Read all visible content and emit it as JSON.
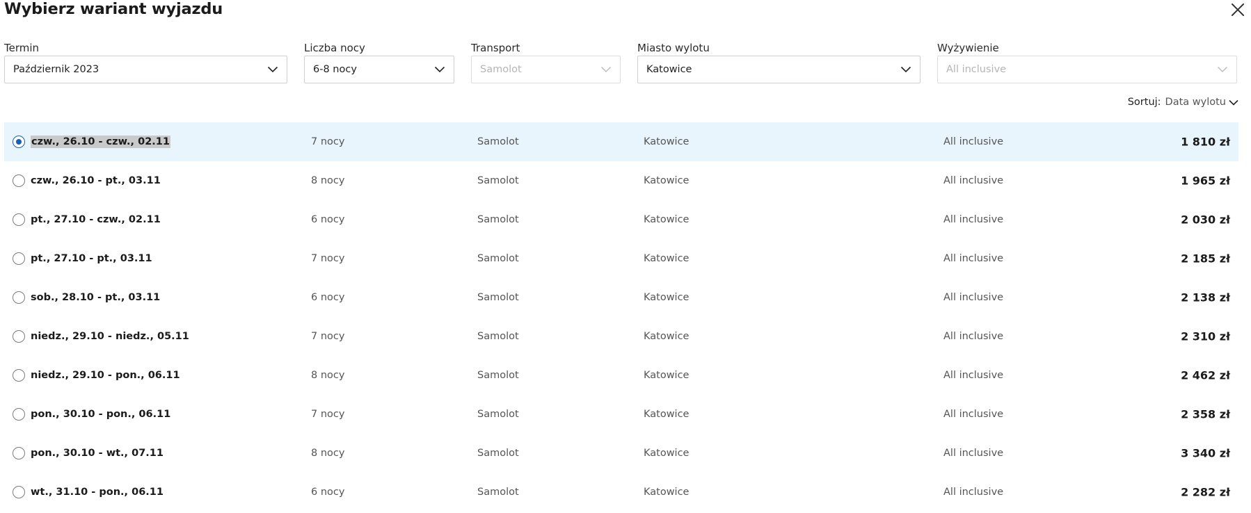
{
  "header": {
    "title": "Wybierz wariant wyjazdu",
    "close_icon": "close-icon"
  },
  "filters": [
    {
      "label": "Termin",
      "value": "Październik 2023",
      "disabled": false
    },
    {
      "label": "Liczba nocy",
      "value": "6-8 nocy",
      "disabled": false
    },
    {
      "label": "Transport",
      "value": "Samolot",
      "disabled": true
    },
    {
      "label": "Miasto wylotu",
      "value": "Katowice",
      "disabled": false
    },
    {
      "label": "Wyżywienie",
      "value": "All inclusive",
      "disabled": true
    }
  ],
  "sort": {
    "label": "Sortuj:",
    "value": "Data wylotu"
  },
  "colors": {
    "selected_row_bg": "#e9f5fc",
    "radio_accent": "#1a5fb4"
  },
  "rows": [
    {
      "dates": "czw., 26.10 - czw., 02.11",
      "nights": "7 nocy",
      "transport": "Samolot",
      "city": "Katowice",
      "board": "All inclusive",
      "price": "1 810 zł",
      "selected": true
    },
    {
      "dates": "czw., 26.10 - pt., 03.11",
      "nights": "8 nocy",
      "transport": "Samolot",
      "city": "Katowice",
      "board": "All inclusive",
      "price": "1 965 zł",
      "selected": false
    },
    {
      "dates": "pt., 27.10 - czw., 02.11",
      "nights": "6 nocy",
      "transport": "Samolot",
      "city": "Katowice",
      "board": "All inclusive",
      "price": "2 030 zł",
      "selected": false
    },
    {
      "dates": "pt., 27.10 - pt., 03.11",
      "nights": "7 nocy",
      "transport": "Samolot",
      "city": "Katowice",
      "board": "All inclusive",
      "price": "2 185 zł",
      "selected": false
    },
    {
      "dates": "sob., 28.10 - pt., 03.11",
      "nights": "6 nocy",
      "transport": "Samolot",
      "city": "Katowice",
      "board": "All inclusive",
      "price": "2 138 zł",
      "selected": false
    },
    {
      "dates": "niedz., 29.10 - niedz., 05.11",
      "nights": "7 nocy",
      "transport": "Samolot",
      "city": "Katowice",
      "board": "All inclusive",
      "price": "2 310 zł",
      "selected": false
    },
    {
      "dates": "niedz., 29.10 - pon., 06.11",
      "nights": "8 nocy",
      "transport": "Samolot",
      "city": "Katowice",
      "board": "All inclusive",
      "price": "2 462 zł",
      "selected": false
    },
    {
      "dates": "pon., 30.10 - pon., 06.11",
      "nights": "7 nocy",
      "transport": "Samolot",
      "city": "Katowice",
      "board": "All inclusive",
      "price": "2 358 zł",
      "selected": false
    },
    {
      "dates": "pon., 30.10 - wt., 07.11",
      "nights": "8 nocy",
      "transport": "Samolot",
      "city": "Katowice",
      "board": "All inclusive",
      "price": "3 340 zł",
      "selected": false
    },
    {
      "dates": "wt., 31.10 - pon., 06.11",
      "nights": "6 nocy",
      "transport": "Samolot",
      "city": "Katowice",
      "board": "All inclusive",
      "price": "2 282 zł",
      "selected": false
    }
  ]
}
